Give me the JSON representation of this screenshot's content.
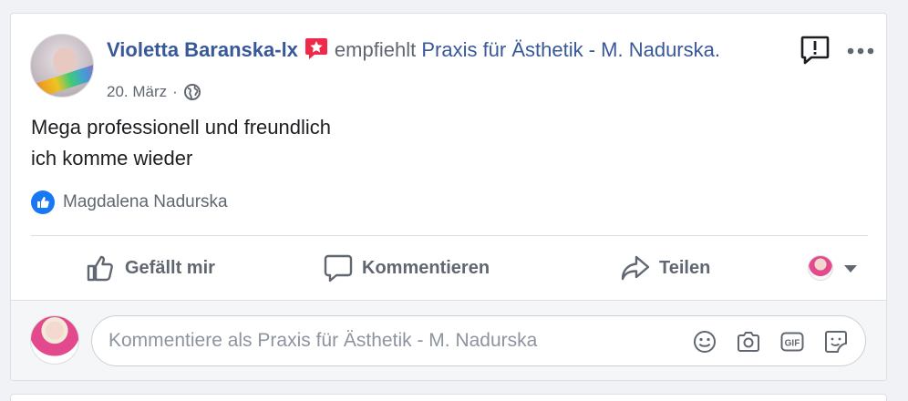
{
  "post": {
    "author": "Violetta Baranska-lx",
    "verb": "empfiehlt",
    "page_name": "Praxis für Ästhetik - M. Nadurska.",
    "date": "20. März",
    "separator": "·",
    "text_line1": "Mega professionell und freundlich",
    "text_line2": "ich komme wieder",
    "reaction_name": "Magdalena Nadurska"
  },
  "actions": {
    "like": "Gefällt mir",
    "comment": "Kommentieren",
    "share": "Teilen"
  },
  "comment": {
    "placeholder": "Kommentiere als Praxis für Ästhetik - M. Nadurska"
  },
  "icons": {
    "recommend": "recommend-star-icon",
    "privacy": "globe-icon",
    "report": "report-icon",
    "more": "more-icon",
    "emoji": "emoji-icon",
    "camera": "camera-icon",
    "gif": "gif-icon",
    "sticker": "sticker-icon"
  },
  "colors": {
    "link": "#385898",
    "muted": "#606770",
    "like_blue": "#1877f2",
    "recommend_red": "#f02849"
  }
}
